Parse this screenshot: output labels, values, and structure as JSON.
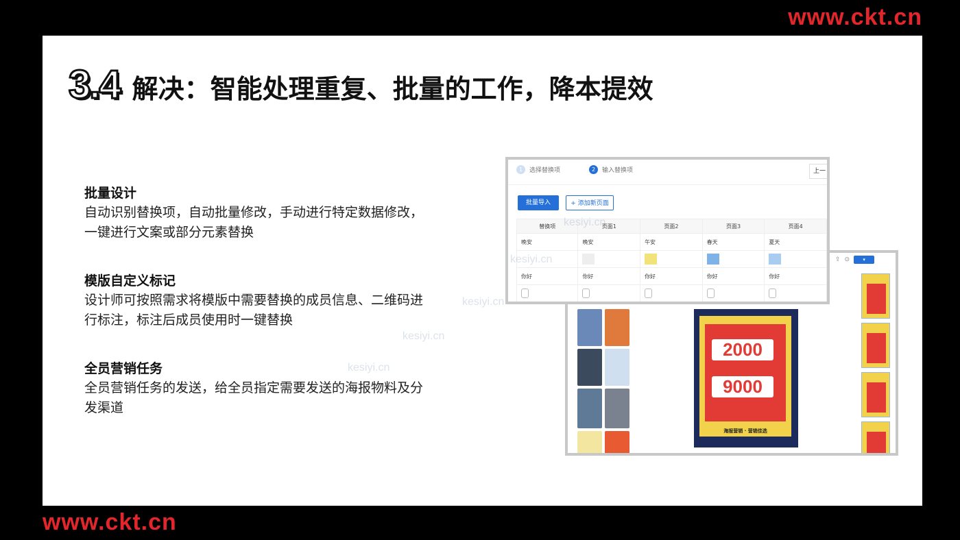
{
  "brand": {
    "top": "www.ckt.cn",
    "bottom": "www.ckt.cn"
  },
  "slide": {
    "section_number": "3.4",
    "title": "解决：智能处理重复、批量的工作，降本提效",
    "features": [
      {
        "heading": "批量设计",
        "lines": [
          "自动识别替换项，自动批量修改，手动进行特定数据修改，",
          "一键进行文案或部分元素替换"
        ]
      },
      {
        "heading": "模版自定义标记",
        "lines": [
          "设计师可按照需求将模版中需要替换的成员信息、二维码进",
          "行标注，标注后成员使用时一键替换"
        ]
      },
      {
        "heading": "全员营销任务",
        "lines": [
          "全员营销任务的发送，给全员指定需要发送的海报物料及分",
          "发渠道"
        ]
      }
    ]
  },
  "screenshot_front": {
    "steps": [
      {
        "num": "1",
        "label": "选择替换项"
      },
      {
        "num": "2",
        "label": "输入替换项"
      }
    ],
    "prev_button": "上一",
    "import_button": "批量导入",
    "add_page_button": "+ 添加新页面",
    "table": {
      "headers": [
        "替换项",
        "页面1",
        "页面2",
        "页面3",
        "页面4"
      ],
      "rows": [
        [
          "晚安",
          "晚安",
          "午安",
          "春天",
          "夏天"
        ],
        [
          "",
          "",
          "",
          "",
          ""
        ],
        [
          "你好",
          "你好",
          "你好",
          "你好",
          "你好"
        ],
        [
          "",
          "",
          "",
          "",
          ""
        ]
      ]
    },
    "image_colors": [
      "#eeeeee",
      "#f2e27a",
      "#7fb2e6",
      "#a9cdf0"
    ]
  },
  "screenshot_back": {
    "poster_numbers": [
      "2000",
      "9000"
    ],
    "poster_slogan": "海报营销 · 营销佳选",
    "toolbar_button": "▾",
    "thumb_colors": [
      "#6a89b8",
      "#e07a3c",
      "#3c4a5e",
      "#cfdff0",
      "#5f7a96",
      "#7a8290",
      "#f2e6a0",
      "#e85a32"
    ]
  },
  "watermarks": [
    "kesiyi.cn",
    "kesiyi.cn",
    "kesiyi.cn",
    "kesiyi.cn",
    "kesiyi.cn"
  ]
}
